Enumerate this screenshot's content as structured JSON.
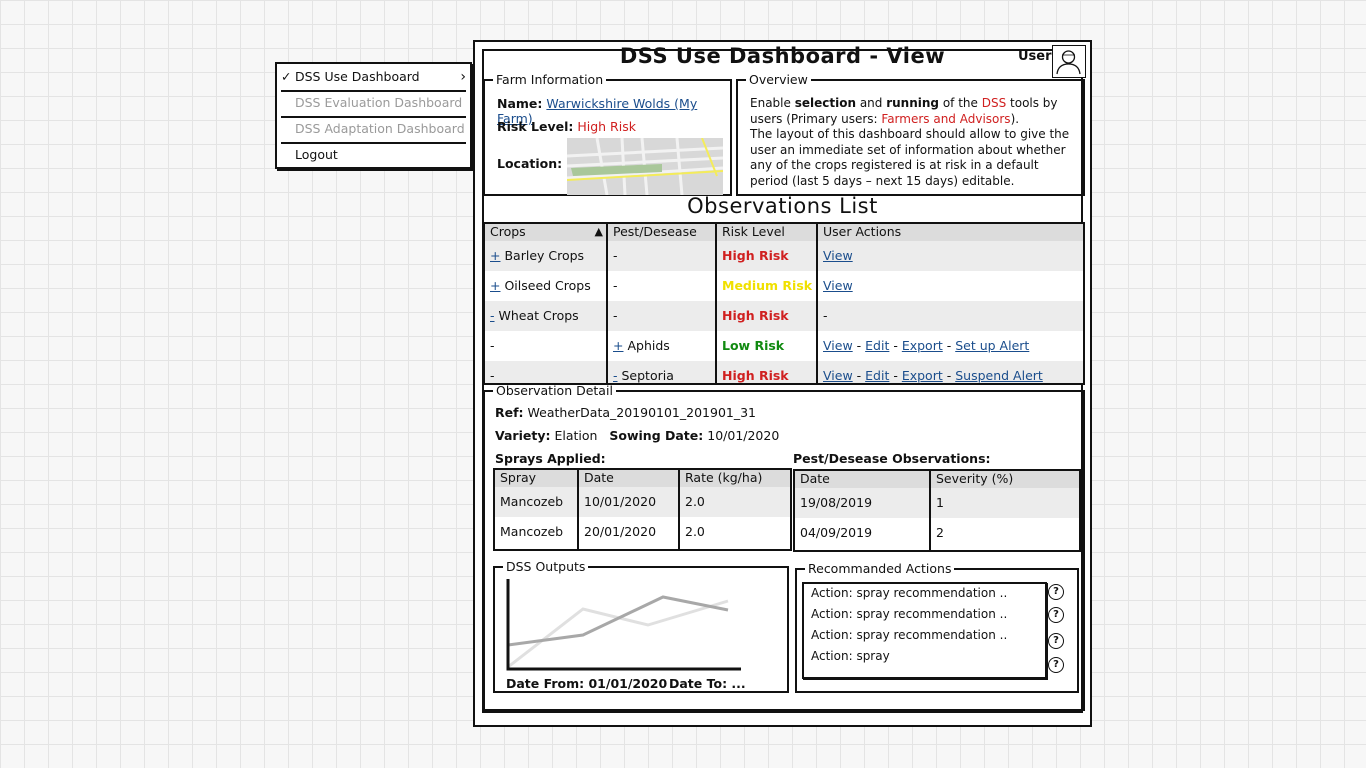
{
  "menu": {
    "items": [
      {
        "label": "DSS Use Dashboard",
        "checked": true,
        "has_submenu": true,
        "enabled": true
      },
      {
        "label": "DSS Evaluation Dashboard",
        "enabled": false
      },
      {
        "label": "DSS Adaptation Dashboard",
        "enabled": false
      },
      {
        "label": "Logout",
        "enabled": true
      }
    ],
    "check_glyph": "✓",
    "chevron_glyph": "›"
  },
  "header": {
    "title": "DSS Use Dashboard - View",
    "user_label": "User:",
    "avatar_icon": "user-avatar-icon"
  },
  "farm": {
    "legend": "Farm Information",
    "name_label": "Name:",
    "name_value": "Warwickshire Wolds (My Farm)",
    "risk_label": "Risk Level:",
    "risk_value": "High Risk",
    "location_label": "Location:"
  },
  "overview": {
    "legend": "Overview",
    "t1": "Enable ",
    "t2": "selection",
    "t3": " and ",
    "t4": "running",
    "t5": " of the ",
    "t6": "DSS",
    "t7": " tools by users (Primary users: ",
    "t8": "Farmers and Advisors",
    "t9": ").",
    "t10": "The layout of this dashboard should allow to give the user an immediate set of information about whether any of the crops registered is at risk in a default period (last 5 days – next 15 days) editable."
  },
  "observations": {
    "title": "Observations List",
    "headers": [
      "Crops",
      "Pest/Desease",
      "Risk Level",
      "User Actions"
    ],
    "sort_glyph": "▲",
    "rows": [
      {
        "toggle": "+",
        "crop": "Barley Crops",
        "pest_toggle": "",
        "pest": "-",
        "risk": "High Risk",
        "risk_level": "high",
        "actions": [
          "View"
        ]
      },
      {
        "toggle": "+",
        "crop": "Oilseed Crops",
        "pest_toggle": "",
        "pest": "-",
        "risk": "Medium Risk",
        "risk_level": "medium",
        "actions": [
          "View"
        ]
      },
      {
        "toggle": "-",
        "crop": "Wheat Crops",
        "pest_toggle": "",
        "pest": "-",
        "risk": "High Risk",
        "risk_level": "high",
        "actions": [
          "-"
        ]
      },
      {
        "toggle": "",
        "crop": "-",
        "pest_toggle": "+",
        "pest": "Aphids",
        "risk": "Low Risk",
        "risk_level": "low",
        "actions": [
          "View",
          "Edit",
          "Export",
          "Set up Alert"
        ]
      },
      {
        "toggle": "",
        "crop": "-",
        "pest_toggle": "-",
        "pest": "Septoria",
        "risk": "High Risk",
        "risk_level": "high",
        "actions": [
          "View",
          "Edit",
          "Export",
          "Suspend Alert"
        ]
      }
    ]
  },
  "detail": {
    "legend": "Observation Detail",
    "ref_label": "Ref:",
    "ref_value": "WeatherData_20190101_201901_31",
    "variety_label": "Variety:",
    "variety_value": "Elation",
    "sowing_label": "Sowing Date:",
    "sowing_value": "10/01/2020",
    "sprays_title": "Sprays Applied:",
    "sprays_headers": [
      "Spray",
      "Date",
      "Rate (kg/ha)"
    ],
    "sprays_rows": [
      [
        "Mancozeb",
        "10/01/2020",
        "2.0"
      ],
      [
        "Mancozeb",
        "20/01/2020",
        "2.0"
      ]
    ],
    "pest_title": "Pest/Desease Observations:",
    "pest_headers": [
      "Date",
      "Severity (%)"
    ],
    "pest_rows": [
      [
        "19/08/2019",
        "1"
      ],
      [
        "04/09/2019",
        "2"
      ]
    ],
    "outputs_legend": "DSS Outputs",
    "date_from_label": "Date From: 01/01/2020",
    "date_to_label": "Date To: ...",
    "actions_legend": "Recommanded Actions",
    "actions": [
      "Action: spray recommendation ..",
      "Action: spray recommendation ..",
      "Action: spray recommendation ..",
      "Action: spray"
    ],
    "help_glyph": "?"
  },
  "colors": {
    "high_risk": "#d02020",
    "medium_risk": "#f0e000",
    "low_risk": "#108a10",
    "link": "#1a4d8c"
  }
}
